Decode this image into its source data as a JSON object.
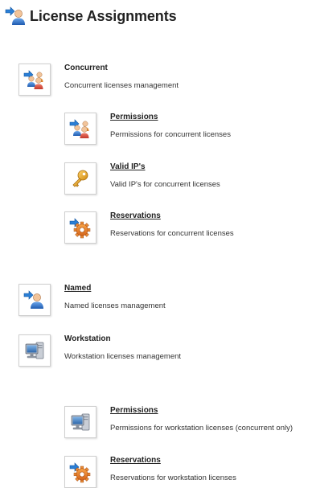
{
  "page": {
    "title": "License Assignments",
    "icon": "users-icon"
  },
  "concurrent": {
    "title": "Concurrent",
    "description": "Concurrent licenses management",
    "icon": "users-group-icon",
    "children": {
      "permissions": {
        "title": "Permissions",
        "description": "Permissions for concurrent licenses",
        "icon": "users-group-icon"
      },
      "valid_ips": {
        "title": "Valid IP's",
        "description": "Valid IP's for concurrent licenses",
        "icon": "key-icon"
      },
      "reservations": {
        "title": "Reservations",
        "description": "Reservations for concurrent licenses",
        "icon": "gear-icon"
      }
    }
  },
  "named": {
    "title": "Named",
    "description": "Named licenses management",
    "icon": "user-icon"
  },
  "workstation": {
    "title": "Workstation",
    "description": "Workstation licenses management",
    "icon": "computer-icon",
    "children": {
      "permissions": {
        "title": "Permissions",
        "description": "Permissions for workstation licenses (concurrent only)",
        "icon": "computer-icon"
      },
      "reservations": {
        "title": "Reservations",
        "description": "Reservations for workstation licenses",
        "icon": "gear-icon"
      }
    }
  },
  "colors": {
    "arrow": "#2a7fd6",
    "user_blue": "#2f6fc0",
    "user_orange": "#e9902a",
    "key": "#e8a020",
    "gear": "#e8771e",
    "skin": "#f2c49a"
  }
}
